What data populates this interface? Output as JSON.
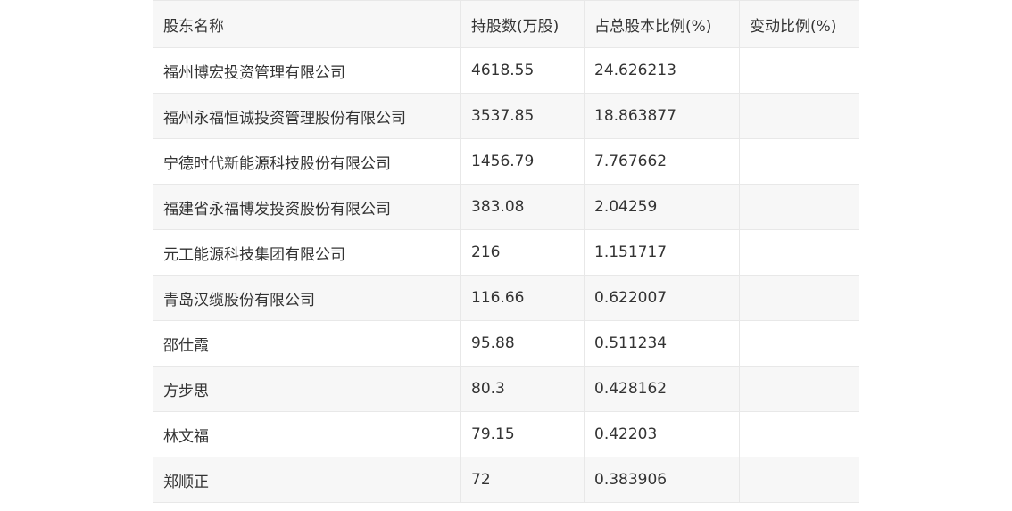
{
  "table": {
    "headers": [
      "股东名称",
      "持股数(万股)",
      "占总股本比例(%)",
      "变动比例(%)"
    ],
    "rows": [
      [
        "福州博宏投资管理有限公司",
        "4618.55",
        "24.626213",
        ""
      ],
      [
        "福州永福恒诚投资管理股份有限公司",
        "3537.85",
        "18.863877",
        ""
      ],
      [
        "宁德时代新能源科技股份有限公司",
        "1456.79",
        "7.767662",
        ""
      ],
      [
        "福建省永福博发投资股份有限公司",
        "383.08",
        "2.04259",
        ""
      ],
      [
        "元工能源科技集团有限公司",
        "216",
        "1.151717",
        ""
      ],
      [
        "青岛汉缆股份有限公司",
        "116.66",
        "0.622007",
        ""
      ],
      [
        "邵仕霞",
        "95.88",
        "0.511234",
        ""
      ],
      [
        "方步思",
        "80.3",
        "0.428162",
        ""
      ],
      [
        "林文福",
        "79.15",
        "0.42203",
        ""
      ],
      [
        "郑顺正",
        "72",
        "0.383906",
        ""
      ]
    ]
  }
}
